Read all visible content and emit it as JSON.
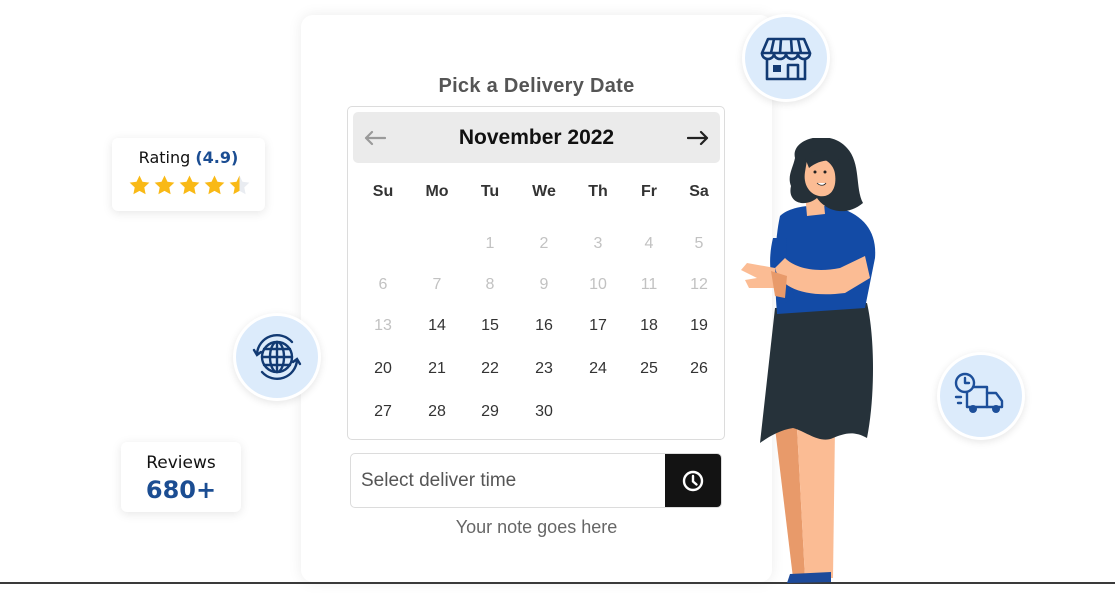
{
  "picker": {
    "title": "Pick a Delivery Date",
    "month_label": "November 2022",
    "prev_icon": "arrow-left-icon",
    "next_icon": "arrow-right-icon",
    "weekdays": [
      "Su",
      "Mo",
      "Tu",
      "We",
      "Th",
      "Fr",
      "Sa"
    ],
    "first_weekday_index": 2,
    "days": [
      {
        "label": "1",
        "disabled": true
      },
      {
        "label": "2",
        "disabled": true
      },
      {
        "label": "3",
        "disabled": true
      },
      {
        "label": "4",
        "disabled": true
      },
      {
        "label": "5",
        "disabled": true
      },
      {
        "label": "6",
        "disabled": true
      },
      {
        "label": "7",
        "disabled": true
      },
      {
        "label": "8",
        "disabled": true
      },
      {
        "label": "9",
        "disabled": true
      },
      {
        "label": "10",
        "disabled": true
      },
      {
        "label": "11",
        "disabled": true
      },
      {
        "label": "12",
        "disabled": true
      },
      {
        "label": "13",
        "disabled": true
      },
      {
        "label": "14",
        "disabled": false
      },
      {
        "label": "15",
        "disabled": false
      },
      {
        "label": "16",
        "disabled": false
      },
      {
        "label": "17",
        "disabled": false
      },
      {
        "label": "18",
        "disabled": false
      },
      {
        "label": "19",
        "disabled": false
      },
      {
        "label": "20",
        "disabled": false
      },
      {
        "label": "21",
        "disabled": false
      },
      {
        "label": "22",
        "disabled": false
      },
      {
        "label": "23",
        "disabled": false
      },
      {
        "label": "24",
        "disabled": false
      },
      {
        "label": "25",
        "disabled": false
      },
      {
        "label": "26",
        "disabled": false
      },
      {
        "label": "27",
        "disabled": false
      },
      {
        "label": "28",
        "disabled": false
      },
      {
        "label": "29",
        "disabled": false
      },
      {
        "label": "30",
        "disabled": false
      }
    ],
    "time_input": {
      "placeholder": "Select deliver time",
      "value": "",
      "icon": "clock-icon"
    },
    "note": "Your note goes here"
  },
  "rating_badge": {
    "label": "Rating",
    "value": "(4.9)",
    "stars": 4.5,
    "max_stars": 5
  },
  "reviews_badge": {
    "label": "Reviews",
    "count": "680+"
  },
  "decor_icons": [
    "store-icon",
    "globe-sync-icon",
    "delivery-truck-clock-icon"
  ],
  "colors": {
    "accent": "#1b4d92",
    "star": "#f9b916",
    "icon_bg": "#dcebfb",
    "button_dark": "#131313"
  }
}
